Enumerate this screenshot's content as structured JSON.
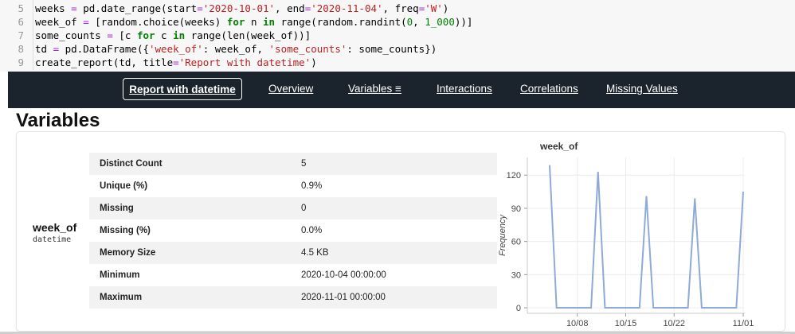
{
  "code": {
    "lines": [
      {
        "n": "5",
        "parts": [
          [
            "weeks ",
            ""
          ],
          [
            "=",
            "op"
          ],
          [
            " pd.date_range(start",
            ""
          ],
          [
            "=",
            "op"
          ],
          [
            "'2020-10-01'",
            "str"
          ],
          [
            ", end",
            ""
          ],
          [
            "=",
            "op"
          ],
          [
            "'2020-11-04'",
            "str"
          ],
          [
            ", freq",
            ""
          ],
          [
            "=",
            "op"
          ],
          [
            "'W'",
            "str"
          ],
          [
            ")",
            ""
          ]
        ]
      },
      {
        "n": "6",
        "parts": [
          [
            "week_of ",
            ""
          ],
          [
            "=",
            "op"
          ],
          [
            " [random.choice(weeks) ",
            ""
          ],
          [
            "for",
            "kw"
          ],
          [
            " n ",
            ""
          ],
          [
            "in",
            "kw"
          ],
          [
            " range(random.randint(",
            ""
          ],
          [
            "0",
            "num"
          ],
          [
            ", ",
            ""
          ],
          [
            "1_000",
            "num"
          ],
          [
            "))]",
            ""
          ]
        ]
      },
      {
        "n": "7",
        "parts": [
          [
            "some_counts ",
            ""
          ],
          [
            "=",
            "op"
          ],
          [
            " [c ",
            ""
          ],
          [
            "for",
            "kw"
          ],
          [
            " c ",
            ""
          ],
          [
            "in",
            "kw"
          ],
          [
            " range(len(week_of))]",
            ""
          ]
        ]
      },
      {
        "n": "8",
        "parts": [
          [
            "td ",
            ""
          ],
          [
            "=",
            "op"
          ],
          [
            " pd.DataFrame({",
            ""
          ],
          [
            "'week_of'",
            "str"
          ],
          [
            ": week_of, ",
            ""
          ],
          [
            "'some_counts'",
            "str"
          ],
          [
            ": some_counts})",
            ""
          ]
        ]
      },
      {
        "n": "9",
        "parts": [
          [
            "create_report(td, title",
            ""
          ],
          [
            "=",
            "op"
          ],
          [
            "'Report with datetime'",
            "str"
          ],
          [
            ")",
            ""
          ]
        ]
      }
    ]
  },
  "nav": {
    "brand": "Report with datetime",
    "links": [
      "Overview",
      "Variables ≡",
      "Interactions",
      "Correlations",
      "Missing Values"
    ]
  },
  "section_title": "Variables",
  "variable": {
    "name": "week_of",
    "dtype": "datetime",
    "stats": [
      {
        "label": "Distinct Count",
        "value": "5"
      },
      {
        "label": "Unique (%)",
        "value": "0.9%"
      },
      {
        "label": "Missing",
        "value": "0"
      },
      {
        "label": "Missing (%)",
        "value": "0.0%"
      },
      {
        "label": "Memory Size",
        "value": "4.5 KB"
      },
      {
        "label": "Minimum",
        "value": "2020-10-04 00:00:00"
      },
      {
        "label": "Maximum",
        "value": "2020-11-01 00:00:00"
      }
    ]
  },
  "chart_data": {
    "type": "line",
    "title": "week_of",
    "xlabel": "",
    "ylabel": "Frequency",
    "x": [
      "10/04",
      "10/05",
      "10/06",
      "10/07",
      "10/08",
      "10/09",
      "10/10",
      "10/11",
      "10/12",
      "10/13",
      "10/14",
      "10/15",
      "10/16",
      "10/17",
      "10/18",
      "10/19",
      "10/20",
      "10/21",
      "10/22",
      "10/23",
      "10/24",
      "10/25",
      "10/26",
      "10/27",
      "10/28",
      "10/29",
      "10/30",
      "10/31",
      "11/01"
    ],
    "values": [
      129,
      0,
      0,
      0,
      0,
      0,
      0,
      123,
      0,
      0,
      0,
      0,
      0,
      0,
      101,
      0,
      0,
      0,
      0,
      0,
      0,
      99,
      0,
      0,
      0,
      0,
      0,
      0,
      105
    ],
    "x_ticks": [
      "10/08",
      "10/15",
      "10/22",
      "11/01"
    ],
    "y_ticks": [
      0,
      30,
      60,
      90,
      120
    ],
    "ylim": [
      -5,
      136
    ],
    "grid": true,
    "color": "#8eaad6"
  }
}
